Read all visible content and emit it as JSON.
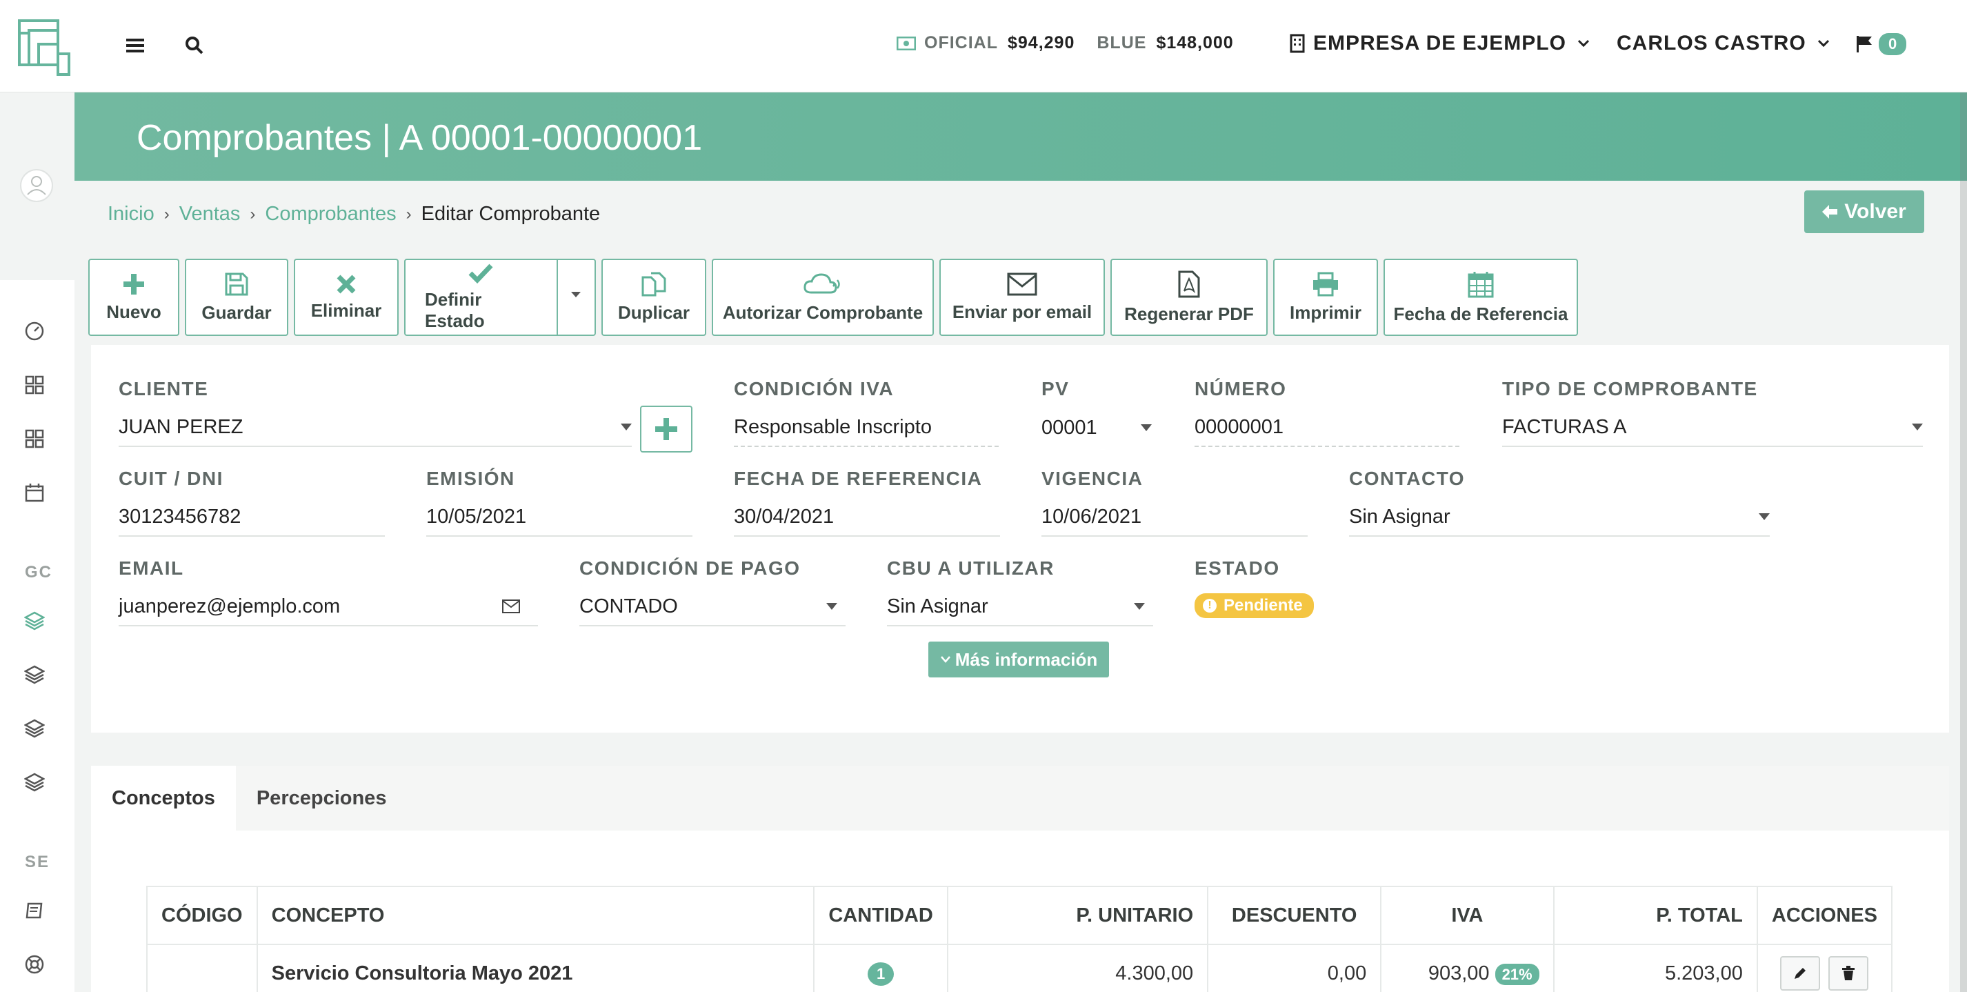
{
  "topbar": {
    "rates": [
      {
        "label": "OFICIAL",
        "value": "$94,290"
      },
      {
        "label": "BLUE",
        "value": "$148,000"
      }
    ],
    "company": "EMPRESA DE EJEMPLO",
    "user": "CARLOS CASTRO",
    "notifications": "0"
  },
  "sidebar": {
    "section_gc": "GC",
    "section_se": "SE"
  },
  "header": {
    "title": "Comprobantes | A 00001-00000001"
  },
  "breadcrumb": {
    "items": [
      "Inicio",
      "Ventas",
      "Comprobantes"
    ],
    "current": "Editar Comprobante"
  },
  "back_button": "Volver",
  "toolbar": {
    "nuevo": "Nuevo",
    "guardar": "Guardar",
    "eliminar": "Eliminar",
    "definir_estado": "Definir Estado",
    "duplicar": "Duplicar",
    "autorizar": "Autorizar Comprobante",
    "enviar": "Enviar por email",
    "regenerar": "Regenerar PDF",
    "imprimir": "Imprimir",
    "fecha_ref": "Fecha de Referencia"
  },
  "form": {
    "cliente": {
      "label": "CLIENTE",
      "value": "JUAN PEREZ"
    },
    "condicion_iva": {
      "label": "CONDICIÓN IVA",
      "value": "Responsable Inscripto"
    },
    "pv": {
      "label": "PV",
      "value": "00001"
    },
    "numero": {
      "label": "NÚMERO",
      "value": "00000001"
    },
    "tipo": {
      "label": "TIPO DE COMPROBANTE",
      "value": "FACTURAS A"
    },
    "cuit": {
      "label": "CUIT / DNI",
      "value": "30123456782"
    },
    "emision": {
      "label": "EMISIÓN",
      "value": "10/05/2021"
    },
    "fecha_referencia": {
      "label": "FECHA DE REFERENCIA",
      "value": "30/04/2021"
    },
    "vigencia": {
      "label": "VIGENCIA",
      "value": "10/06/2021"
    },
    "contacto": {
      "label": "CONTACTO",
      "value": "Sin Asignar"
    },
    "email": {
      "label": "EMAIL",
      "value": "juanperez@ejemplo.com"
    },
    "condicion_pago": {
      "label": "CONDICIÓN DE PAGO",
      "value": "CONTADO"
    },
    "cbu": {
      "label": "CBU A UTILIZAR",
      "value": "Sin Asignar"
    },
    "estado": {
      "label": "ESTADO",
      "value": "Pendiente",
      "color": "#f4c542"
    },
    "more_info": "Más información"
  },
  "tabs": [
    "Conceptos",
    "Percepciones"
  ],
  "table": {
    "headers": [
      "CÓDIGO",
      "CONCEPTO",
      "CANTIDAD",
      "P. UNITARIO",
      "DESCUENTO",
      "IVA",
      "P. TOTAL",
      "ACCIONES"
    ],
    "rows": [
      {
        "codigo": "",
        "concepto": "Servicio Consultoria Mayo 2021",
        "cantidad": "1",
        "p_unitario": "4.300,00",
        "descuento": "0,00",
        "iva": "903,00",
        "iva_pct": "21%",
        "p_total": "5.203,00"
      }
    ]
  },
  "colors": {
    "accent": "#5eb197",
    "warning": "#f4c542"
  }
}
